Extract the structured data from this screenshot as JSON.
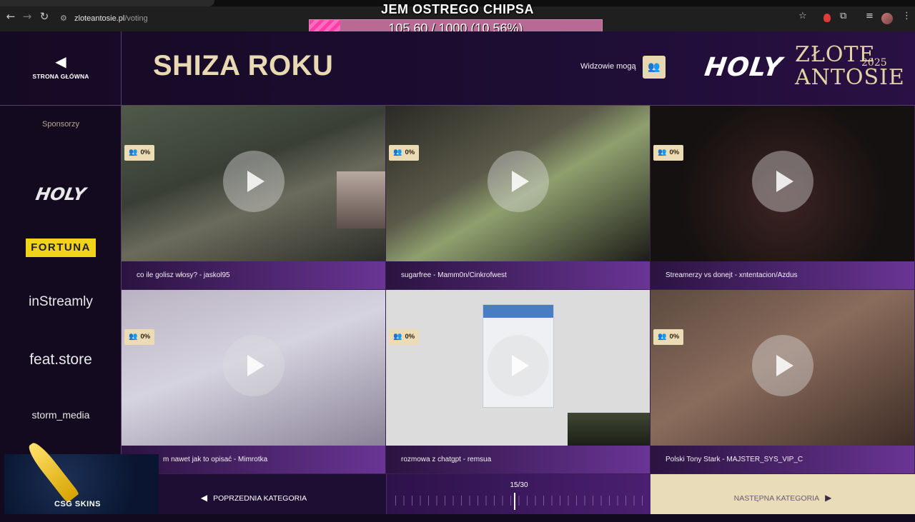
{
  "browser": {
    "url_host": "zloteantosie.pl",
    "url_path": "/voting"
  },
  "goal": {
    "title": "JEM OSTREGO CHIPSA",
    "progress_text": "105.60 / 1000 (10.56%)",
    "progress_fraction": 0.1056
  },
  "header": {
    "back_label": "STRONA GŁÓWNA",
    "page_title": "SHIZA ROKU",
    "viewers_label": "Widzowie mogą",
    "logo_holy": "HOLY",
    "logo_line1": "ZŁOTE",
    "logo_line2": "ANTOSIE",
    "logo_year": "2025"
  },
  "sidebar": {
    "title": "Sponsorzy",
    "sponsors": [
      "HOLY",
      "FORTUNA",
      "inStreamly",
      "feat.store",
      "storm_media"
    ]
  },
  "overlay": {
    "csgo_label": "CSG SKINS"
  },
  "cards": [
    {
      "percent": "0%",
      "caption": "co ile golisz włosy? - jaskol95"
    },
    {
      "percent": "0%",
      "caption": "sugarfree - Mamm0n/Cinkrofwest"
    },
    {
      "percent": "0%",
      "caption": "Streamerzy vs donejt - xntentacion/Azdus"
    },
    {
      "percent": "0%",
      "caption": "m nawet jak to opisać - Mimrotka"
    },
    {
      "percent": "0%",
      "caption": "rozmowa z chatgpt - remsua"
    },
    {
      "percent": "0%",
      "caption": "Polski Tony Stark - MAJSTER_SYS_VIP_C"
    }
  ],
  "footer": {
    "prev_label": "POPRZEDNIA KATEGORIA",
    "counter": "15/30",
    "next_label": "NASTĘPNA KATEGORIA"
  },
  "colors": {
    "accent_gold": "#e8d9b3",
    "background": "#150a24",
    "caption_purple": "#6a3595",
    "goal_pink": "#ff3ea5"
  }
}
